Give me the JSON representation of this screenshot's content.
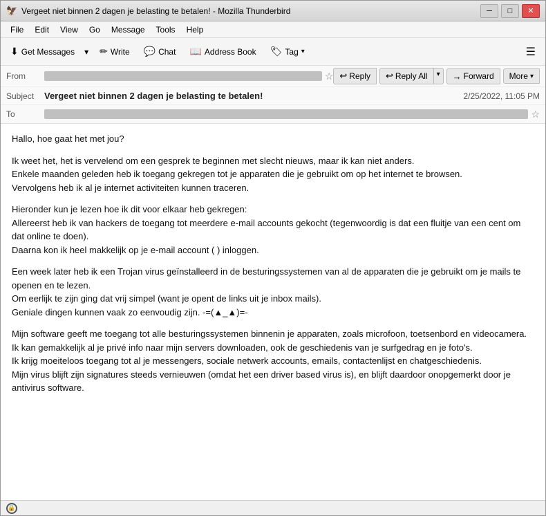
{
  "window": {
    "title": "Vergeet niet binnen 2 dagen je belasting te betalen! - Mozilla Thunderbird",
    "icon": "🦅"
  },
  "menu": {
    "items": [
      "File",
      "Edit",
      "View",
      "Go",
      "Message",
      "Tools",
      "Help"
    ]
  },
  "toolbar": {
    "get_messages": "Get Messages",
    "write": "Write",
    "chat": "Chat",
    "address_book": "Address Book",
    "tag": "Tag"
  },
  "header": {
    "from_label": "From",
    "from_value_redacted": true,
    "subject_label": "Subject",
    "subject_value": "Vergeet niet binnen 2 dagen je belasting te betalen!",
    "to_label": "To",
    "to_value_redacted": true,
    "date": "2/25/2022, 11:05 PM",
    "reply_label": "Reply",
    "reply_all_label": "Reply All",
    "forward_label": "Forward",
    "more_label": "More"
  },
  "body": {
    "paragraphs": [
      "Hallo, hoe gaat het met jou?",
      "Ik weet het, het is vervelend om een gesprek te beginnen met slecht nieuws, maar ik kan niet anders.\nEnkele maanden geleden heb ik toegang gekregen tot je apparaten die je gebruikt om op het internet te browsen.\nVervolgens heb ik al je internet activiteiten kunnen traceren.",
      "Hieronder kun je lezen hoe ik dit voor elkaar heb gekregen:\nAllereerst heb ik van hackers de toegang tot meerdere e-mail accounts gekocht (tegenwoordig is dat een fluitje van een cent om dat online te doen).\nDaarna kon ik heel makkelijk op je e-mail account (                    ) inloggen.",
      "Een week later heb ik een Trojan virus geïnstalleerd in de besturingssystemen van al de apparaten die je gebruikt om je mails te openen en te lezen.\nOm eerlijk te zijn ging dat vrij simpel (want je opent de links uit je inbox mails).\nGeniale dingen kunnen vaak zo eenvoudig zijn. -=(▲_▲)=-",
      "Mijn software geeft me toegang tot alle besturingssystemen binnenin je apparaten, zoals microfoon, toetsenbord en videocamera.\nIk kan gemakkelijk al je privé info naar mijn servers downloaden, ook de geschiedenis van je surfgedrag en je foto's.\nIk krijg moeiteloos toegang tot al je messengers, sociale netwerk accounts, emails, contactenlijst en chatgeschiedenis.\nMijn virus blijft zijn signatures steeds vernieuwen (omdat het een driver based virus is), en blijft daardoor onopgemerkt door je antivirus software."
    ]
  },
  "status_bar": {
    "icon": "🔒",
    "text": ""
  }
}
